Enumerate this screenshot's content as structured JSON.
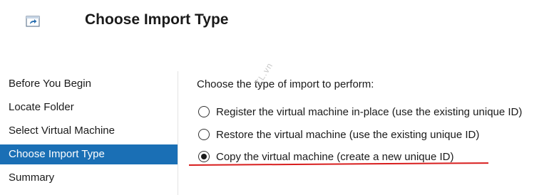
{
  "header": {
    "icon": "import-arrow-icon",
    "title": "Choose Import Type"
  },
  "sidebar": {
    "items": [
      {
        "label": "Before You Begin",
        "selected": false
      },
      {
        "label": "Locate Folder",
        "selected": false
      },
      {
        "label": "Select Virtual Machine",
        "selected": false
      },
      {
        "label": "Choose Import Type",
        "selected": true
      },
      {
        "label": "Summary",
        "selected": false
      }
    ],
    "selected_color": "#1a6fb5"
  },
  "main": {
    "prompt": "Choose the type of import to perform:",
    "options": [
      {
        "label": "Register the virtual machine in-place (use the existing unique ID)",
        "checked": false
      },
      {
        "label": "Restore the virtual machine (use the existing unique ID)",
        "checked": false
      },
      {
        "label": "Copy the virtual machine (create a new unique ID)",
        "checked": true
      }
    ],
    "annotation_color": "#d81e1e"
  },
  "watermark": "TL.vn"
}
